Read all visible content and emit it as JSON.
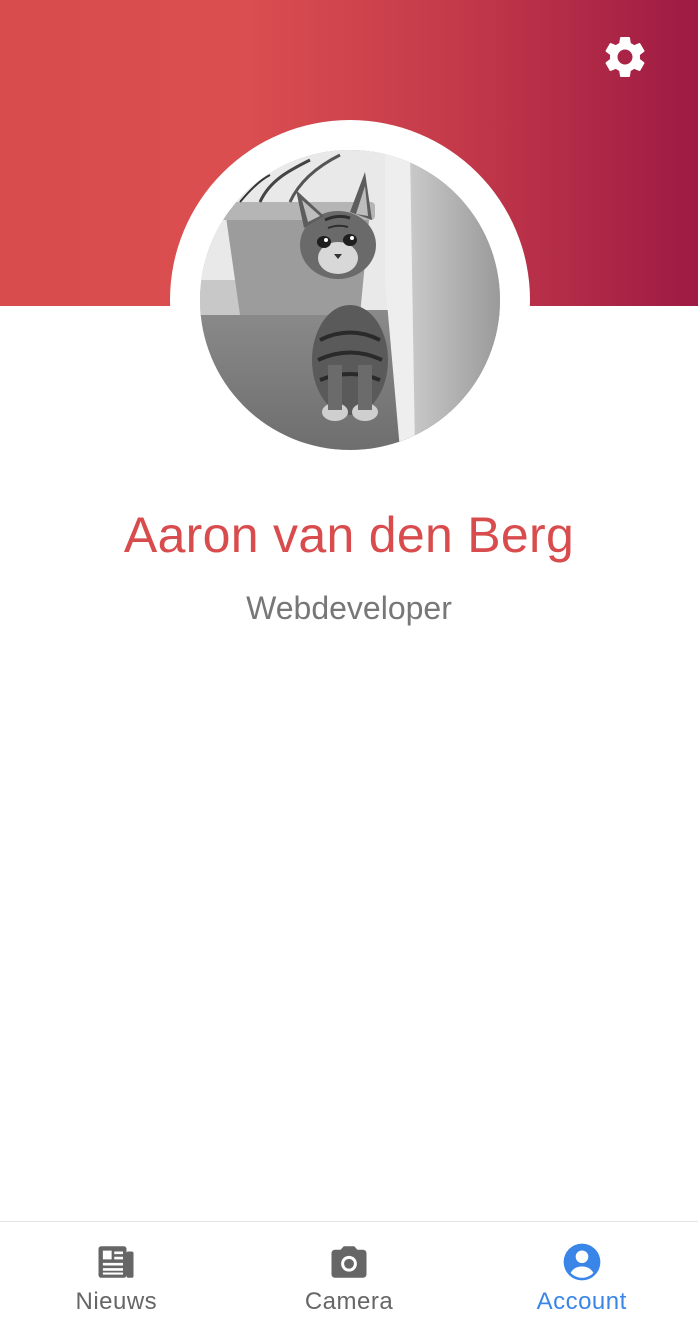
{
  "profile": {
    "name": "Aaron van den Berg",
    "role": "Webdeveloper",
    "avatar_description": "cat-photo"
  },
  "header": {
    "settings_icon": "gear-icon"
  },
  "nav": {
    "items": [
      {
        "label": "Nieuws",
        "icon": "newspaper-icon",
        "active": false
      },
      {
        "label": "Camera",
        "icon": "camera-icon",
        "active": false
      },
      {
        "label": "Account",
        "icon": "account-circle-icon",
        "active": true
      }
    ]
  },
  "colors": {
    "brand_red": "#d94c4d",
    "gradient_end": "#9e1a44",
    "active_nav": "#3a86e8",
    "inactive_nav": "#666666",
    "subtitle": "#777777"
  }
}
